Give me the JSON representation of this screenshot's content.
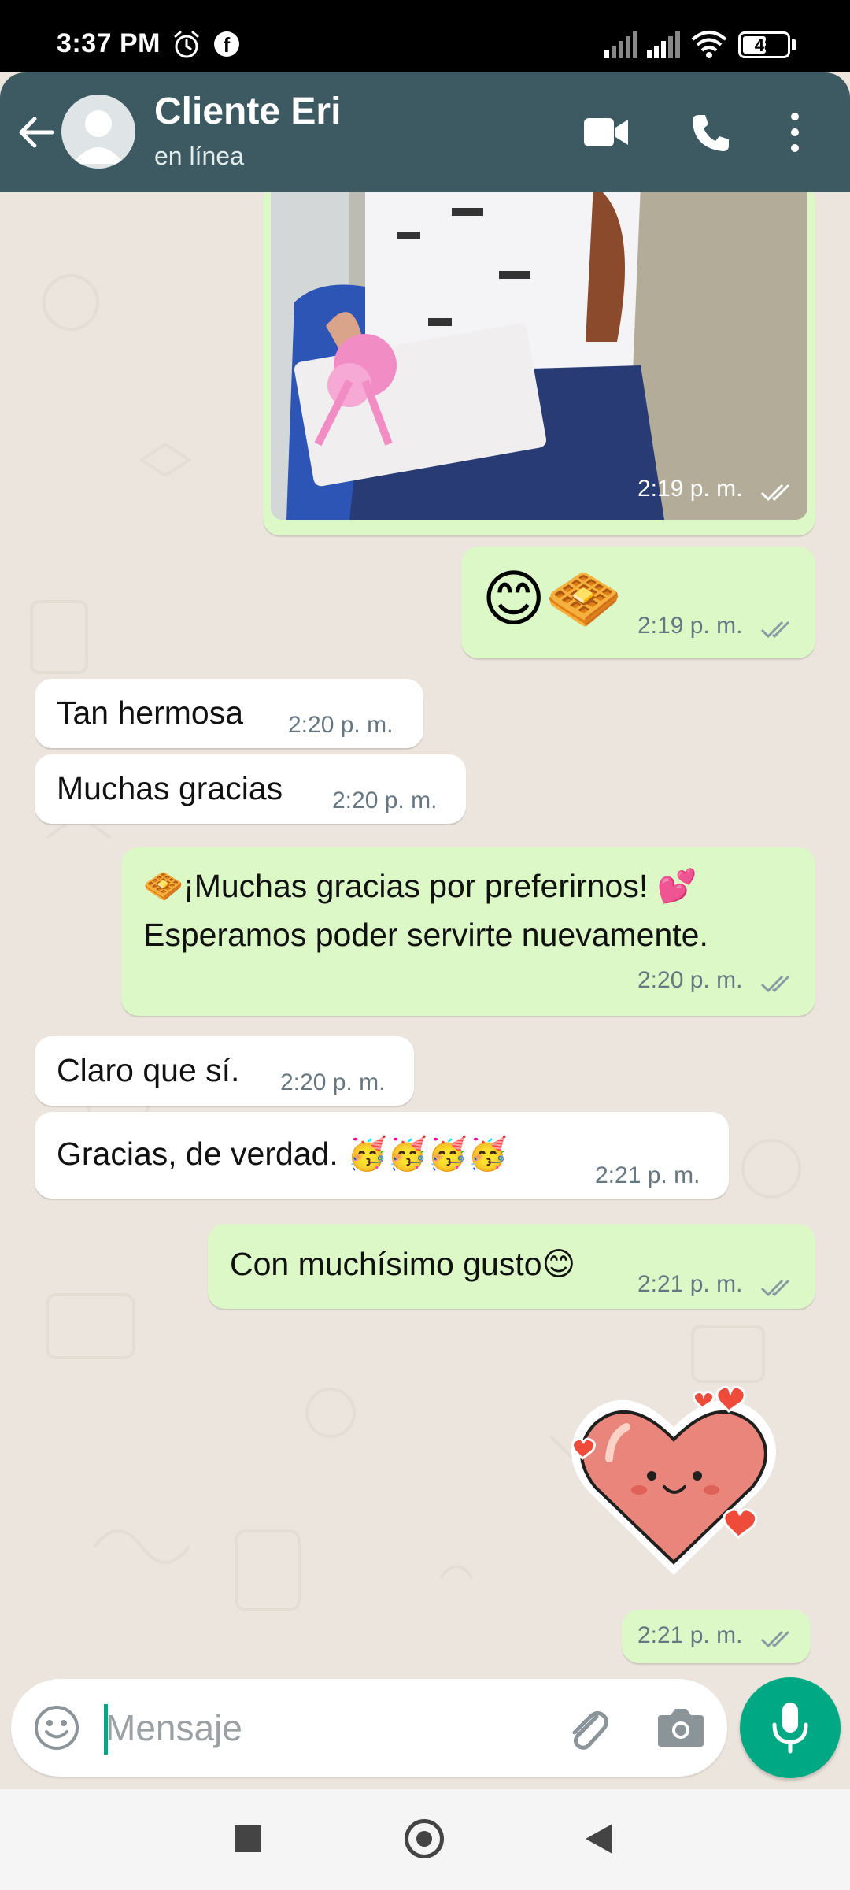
{
  "status_bar": {
    "time": "3:37 PM",
    "battery": "48",
    "icons": [
      "alarm-icon",
      "facebook-icon",
      "signal-icon",
      "signal-icon",
      "wifi-icon",
      "battery-icon"
    ]
  },
  "header": {
    "contact_name": "Cliente Eri",
    "status": "en línea",
    "icons": [
      "back-arrow-icon",
      "avatar-icon",
      "video-call-icon",
      "voice-call-icon",
      "more-vert-icon"
    ]
  },
  "messages": [
    {
      "direction": "out",
      "type": "image",
      "time": "2:19 p. m.",
      "ticks": "read"
    },
    {
      "direction": "out",
      "type": "emoji",
      "emoji": "😊🧇",
      "time": "2:19 p. m.",
      "ticks": "read"
    },
    {
      "direction": "in",
      "text": "Tan hermosa",
      "time": "2:20 p. m."
    },
    {
      "direction": "in",
      "text": "Muchas gracias",
      "time": "2:20 p. m."
    },
    {
      "direction": "out",
      "line1": "🧇¡Muchas gracias por preferirnos! 💕",
      "line2": "Esperamos poder servirte nuevamente.",
      "time": "2:20 p. m.",
      "ticks": "read"
    },
    {
      "direction": "in",
      "text": "Claro que sí.",
      "time": "2:20 p. m."
    },
    {
      "direction": "in",
      "text": "Gracias, de verdad. 🥳🥳🥳🥳",
      "time": "2:21 p. m."
    },
    {
      "direction": "out",
      "text": "Con muchísimo gusto😊",
      "time": "2:21 p. m.",
      "ticks": "read"
    },
    {
      "direction": "out",
      "type": "sticker",
      "sticker": "heart-face-sticker",
      "time": "2:21 p. m.",
      "ticks": "read"
    }
  ],
  "input_bar": {
    "placeholder": "Mensaje",
    "icons": [
      "emoji-icon",
      "attach-icon",
      "camera-icon",
      "mic-icon"
    ]
  },
  "nav_bar": {
    "icons": [
      "recent-apps-icon",
      "home-icon",
      "back-icon"
    ]
  },
  "colors": {
    "header": "#3d5a62",
    "outgoing_bubble": "#dcf8c6",
    "incoming_bubble": "#ffffff",
    "chat_background": "#ece5dd",
    "accent": "#00a884",
    "read_ticks": "#667781"
  }
}
